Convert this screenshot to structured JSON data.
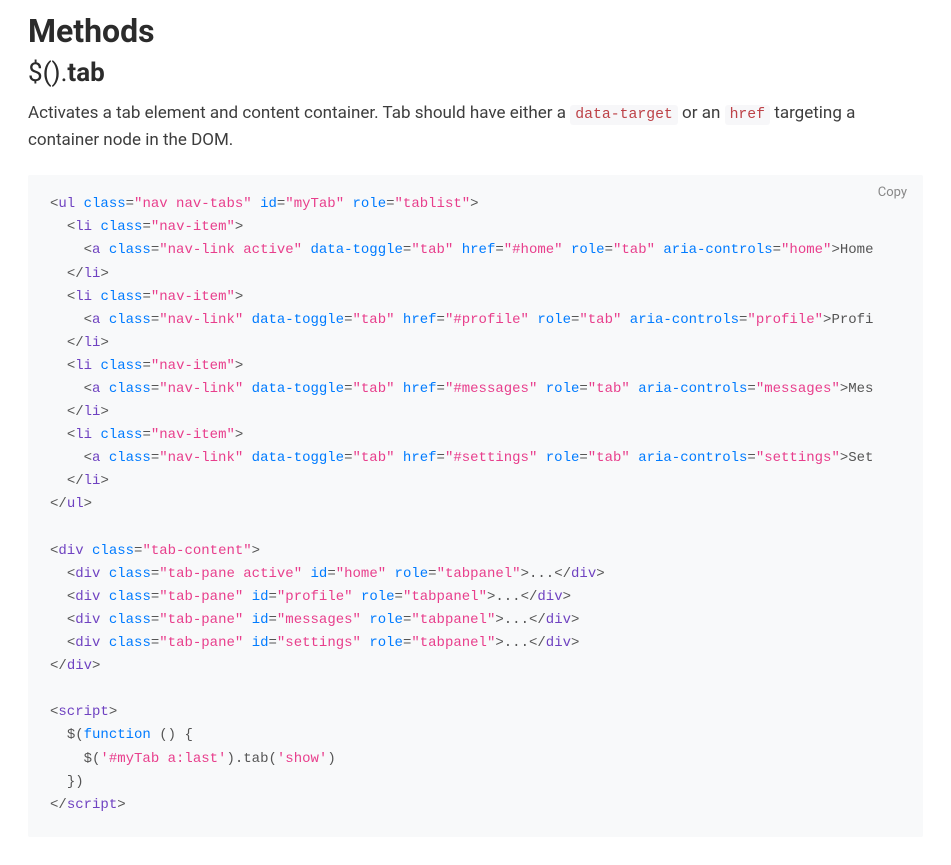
{
  "heading": "Methods",
  "subheading_prefix": "$().",
  "subheading_fn": "tab",
  "desc_before": "Activates a tab element and content container. Tab should have either a ",
  "desc_code1": "data-target",
  "desc_mid": " or an ",
  "desc_code2": "href",
  "desc_after": " targeting a container node in the DOM.",
  "copy_label": "Copy",
  "code": {
    "ul_tag": "ul",
    "li_tag": "li",
    "a_tag": "a",
    "div_tag": "div",
    "script_tag": "script",
    "class_attr": "class",
    "id_attr": "id",
    "role_attr": "role",
    "data_toggle_attr": "data-toggle",
    "href_attr": "href",
    "aria_controls_attr": "aria-controls",
    "ul_class": "\"nav nav-tabs\"",
    "ul_id": "\"myTab\"",
    "ul_role": "\"tablist\"",
    "li_class": "\"nav-item\"",
    "a_class_active": "\"nav-link active\"",
    "a_class": "\"nav-link\"",
    "toggle_val": "\"tab\"",
    "role_tab": "\"tab\"",
    "role_tabpanel": "\"tabpanel\"",
    "href_home": "\"#home\"",
    "href_profile": "\"#profile\"",
    "href_messages": "\"#messages\"",
    "href_settings": "\"#settings\"",
    "ac_home": "\"home\"",
    "ac_profile": "\"profile\"",
    "ac_messages": "\"messages\"",
    "ac_settings": "\"settings\"",
    "txt_home": "Home",
    "txt_profile": "Profi",
    "txt_messages": "Mes",
    "txt_settings": "Set",
    "tabcontent_class": "\"tab-content\"",
    "pane_active_class": "\"tab-pane active\"",
    "pane_class": "\"tab-pane\"",
    "id_home": "\"home\"",
    "id_profile": "\"profile\"",
    "id_messages": "\"messages\"",
    "id_settings": "\"settings\"",
    "dots": "...",
    "js_func": "function",
    "js_jq": "$",
    "js_open": " () {",
    "js_sel": "'#myTab a:last'",
    "js_tab": "tab",
    "js_show": "'show'",
    "js_close": "})"
  }
}
